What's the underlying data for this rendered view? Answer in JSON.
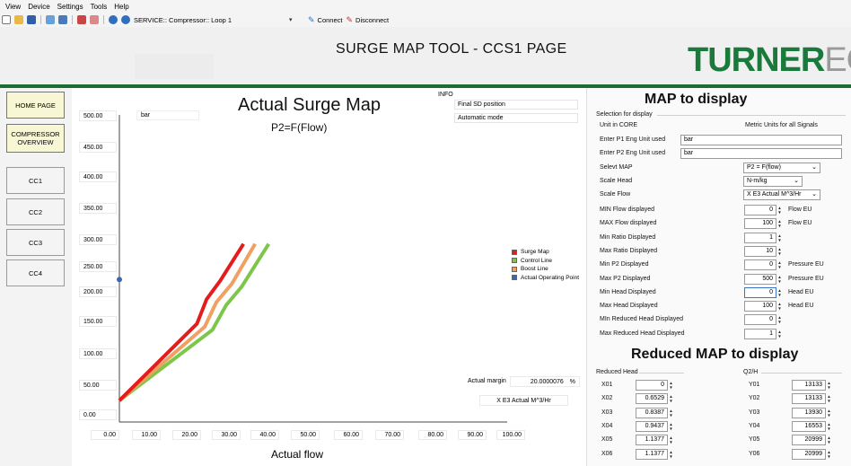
{
  "menu": {
    "items": [
      "View",
      "Device",
      "Settings",
      "Tools",
      "Help"
    ]
  },
  "toolbar": {
    "service_combo": "SERVICE:: Compressor:: Loop 1",
    "connect_label": "Connect",
    "disconnect_label": "Disconnect"
  },
  "header": {
    "page_title": "SURGE MAP TOOL - CCS1 PAGE",
    "logo_main": "TURNER",
    "logo_suffix": "ECS"
  },
  "nav": {
    "items": [
      "HOME PAGE",
      "COMPRESSOR\nOVERVIEW",
      "CC1",
      "CC2",
      "CC3",
      "CC4"
    ]
  },
  "plot": {
    "title": "Actual Surge Map",
    "subtitle": "P2=F(Flow)",
    "unit_top": "bar",
    "x_axis_label": "Actual flow",
    "y_ticks": [
      "500.00",
      "450.00",
      "400.00",
      "350.00",
      "300.00",
      "250.00",
      "200.00",
      "150.00",
      "100.00",
      "50.00",
      "0.00"
    ],
    "x_ticks": [
      "0.00",
      "10.00",
      "20.00",
      "30.00",
      "40.00",
      "50.00",
      "60.00",
      "70.00",
      "80.00",
      "90.00",
      "100.00"
    ],
    "legend": [
      {
        "label": "Surge Map",
        "color": "#e41c1c"
      },
      {
        "label": "Control Line",
        "color": "#7ec64a"
      },
      {
        "label": "Boost Line",
        "color": "#f0a060"
      },
      {
        "label": "Actual Operating Point",
        "color": "#3b66b0"
      }
    ],
    "margin_label": "Actual margin",
    "margin_value": "20.0000076",
    "margin_unit": "%",
    "flow_unit": "X E3 Actual M^3/Hr"
  },
  "chart_data": {
    "type": "line",
    "title": "Actual Surge Map",
    "subtitle": "P2=F(Flow)",
    "xlabel": "Actual flow",
    "ylabel": "bar",
    "xlim": [
      0,
      100
    ],
    "ylim": [
      0,
      500
    ],
    "series": [
      {
        "name": "Surge Map",
        "color": "#e41c1c",
        "x": [
          0,
          20,
          22.5,
          26,
          32
        ],
        "y": [
          35,
          160,
          200,
          230,
          290
        ]
      },
      {
        "name": "Control Line",
        "color": "#7ec64a",
        "x": [
          0,
          24,
          27.5,
          31.5,
          38.5
        ],
        "y": [
          35,
          150,
          190,
          220,
          290
        ]
      },
      {
        "name": "Boost Line",
        "color": "#f0a060",
        "x": [
          0,
          22,
          25,
          29,
          35
        ],
        "y": [
          35,
          155,
          195,
          225,
          290
        ]
      },
      {
        "name": "Actual Operating Point",
        "color": "#3b66b0",
        "x": [
          0
        ],
        "y": [
          232
        ]
      }
    ]
  },
  "info": {
    "label": "INFO",
    "lines": [
      "Final SD position",
      "Automatic mode"
    ]
  },
  "map_panel": {
    "title": "MAP to display",
    "group_label": "Selection for display",
    "unit_in_core_label": "Unit in CORE",
    "unit_in_core_value": "Metric Units for all Signals",
    "p1_label": "Enter P1 Eng Unit used",
    "p1_value": "bar",
    "p2_label": "Enter P2 Eng Unit used",
    "p2_value": "bar",
    "select_map_label": "Selevt MAP",
    "select_map_value": "P2 = F(flow)",
    "scale_head_label": "Scale Head",
    "scale_head_value": "N-m/kg",
    "scale_flow_label": "Scale Flow",
    "scale_flow_value": "X E3 Actual M^3/Hr",
    "rows": [
      {
        "label": "MIN Flow displayed",
        "value": "0",
        "unit": "Flow EU"
      },
      {
        "label": "MAX Flow displayed",
        "value": "100",
        "unit": "Flow EU"
      },
      {
        "label": "Min Ratio Displayed",
        "value": "1",
        "unit": ""
      },
      {
        "label": "Max Ratio Displayed",
        "value": "10",
        "unit": ""
      },
      {
        "label": "Min P2 Displayed",
        "value": "0",
        "unit": "Pressure EU"
      },
      {
        "label": "Max P2 Displayed",
        "value": "500",
        "unit": "Pressure EU"
      },
      {
        "label": "Min Head Displayed",
        "value": "0",
        "unit": "Head EU"
      },
      {
        "label": "Max Head Displayed",
        "value": "100",
        "unit": "Head EU"
      },
      {
        "label": "MIn Reduced Head Displayed",
        "value": "0",
        "unit": ""
      },
      {
        "label": "Max Reduced Head Displayed",
        "value": "1",
        "unit": ""
      }
    ]
  },
  "reduced_panel": {
    "title": "Reduced MAP to display",
    "left_group": "Reduced Head",
    "right_group": "Q2/H",
    "x_rows": [
      {
        "label": "X01",
        "value": "0"
      },
      {
        "label": "X02",
        "value": "0.6529"
      },
      {
        "label": "X03",
        "value": "0.8387"
      },
      {
        "label": "X04",
        "value": "0.9437"
      },
      {
        "label": "X05",
        "value": "1.1377"
      },
      {
        "label": "X06",
        "value": "1.1377"
      }
    ],
    "y_rows": [
      {
        "label": "Y01",
        "value": "13133"
      },
      {
        "label": "Y02",
        "value": "13133"
      },
      {
        "label": "Y03",
        "value": "13930"
      },
      {
        "label": "Y04",
        "value": "16553"
      },
      {
        "label": "Y05",
        "value": "20999"
      },
      {
        "label": "Y06",
        "value": "20999"
      }
    ]
  }
}
